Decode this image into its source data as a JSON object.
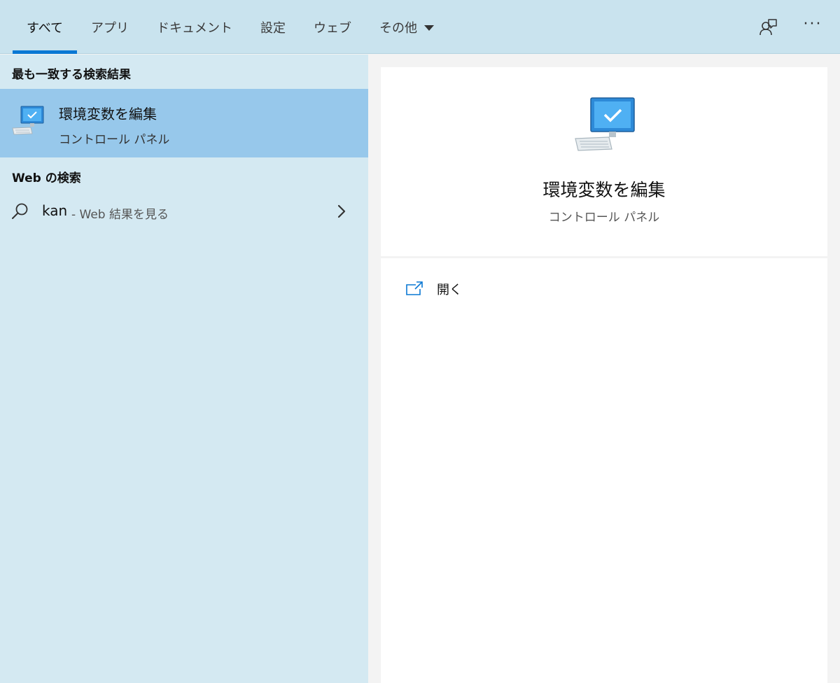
{
  "tabs": [
    {
      "label": "すべて",
      "active": true
    },
    {
      "label": "アプリ"
    },
    {
      "label": "ドキュメント"
    },
    {
      "label": "設定"
    },
    {
      "label": "ウェブ"
    },
    {
      "label": "その他"
    }
  ],
  "topbar": {
    "feedback_icon": "feedback-person-icon",
    "more_label": "···"
  },
  "left": {
    "best_match_heading": "最も一致する検索結果",
    "best_match": {
      "title": "環境変数を編集",
      "subtitle": "コントロール パネル",
      "icon": "control-panel-monitor-icon"
    },
    "web_heading": "Web の検索",
    "web_result": {
      "query": "kan",
      "suffix": "- Web 結果を見る",
      "icon": "search-icon"
    }
  },
  "preview": {
    "title": "環境変数を編集",
    "subtitle": "コントロール パネル",
    "actions": [
      {
        "label": "開く",
        "icon": "open-window-icon"
      }
    ]
  },
  "colors": {
    "accent": "#0a78d4",
    "selected": "#97c8eb",
    "panel": "#d4e9f2",
    "topbar": "#c9e3ee"
  }
}
